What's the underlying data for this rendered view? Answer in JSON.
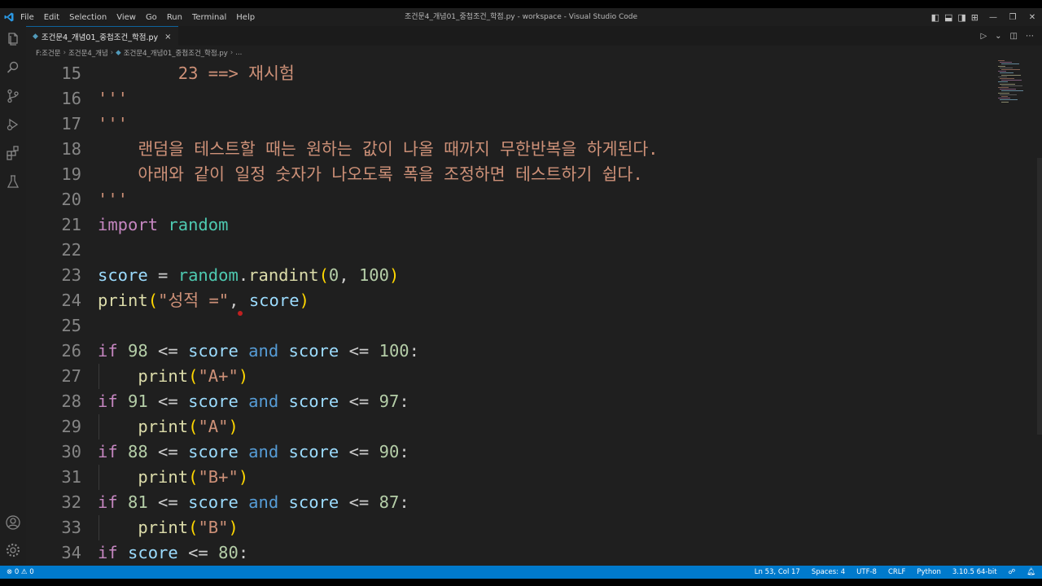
{
  "titlebar": {
    "menu": [
      "File",
      "Edit",
      "Selection",
      "View",
      "Go",
      "Run",
      "Terminal",
      "Help"
    ],
    "title": "조건문4_개념01_중첩조건_학점.py - workspace - Visual Studio Code"
  },
  "tabs": [
    {
      "label": "조건문4_개념01_중첩조건_학점.py",
      "close": "×"
    }
  ],
  "breadcrumb": {
    "items": [
      "F:조건문",
      "조건문4_개념",
      "조건문4_개념01_중첩조건_학점.py",
      "..."
    ]
  },
  "editor": {
    "lines": [
      {
        "n": "15",
        "tokens": [
          {
            "t": "        ",
            "c": ""
          },
          {
            "t": "23 ==> 재시험",
            "c": "str"
          }
        ]
      },
      {
        "n": "16",
        "tokens": [
          {
            "t": "'''",
            "c": "str"
          }
        ]
      },
      {
        "n": "17",
        "tokens": [
          {
            "t": "'''",
            "c": "str"
          }
        ]
      },
      {
        "n": "18",
        "tokens": [
          {
            "t": "    랜덤을 테스트할 때는 원하는 값이 나올 때까지 무한반복을 하게된다.",
            "c": "str"
          }
        ]
      },
      {
        "n": "19",
        "tokens": [
          {
            "t": "    아래와 같이 일정 숫자가 나오도록 폭을 조정하면 테스트하기 쉽다.",
            "c": "str"
          }
        ]
      },
      {
        "n": "20",
        "tokens": [
          {
            "t": "'''",
            "c": "str"
          }
        ]
      },
      {
        "n": "21",
        "tokens": [
          {
            "t": "import",
            "c": "kw"
          },
          {
            "t": " ",
            "c": ""
          },
          {
            "t": "random",
            "c": "mod"
          }
        ]
      },
      {
        "n": "22",
        "tokens": []
      },
      {
        "n": "23",
        "tokens": [
          {
            "t": "score",
            "c": "var"
          },
          {
            "t": " = ",
            "c": "pun"
          },
          {
            "t": "random",
            "c": "mod"
          },
          {
            "t": ".",
            "c": "pun"
          },
          {
            "t": "randint",
            "c": "fn"
          },
          {
            "t": "(",
            "c": "par"
          },
          {
            "t": "0",
            "c": "num"
          },
          {
            "t": ", ",
            "c": "pun"
          },
          {
            "t": "100",
            "c": "num"
          },
          {
            "t": ")",
            "c": "par"
          }
        ]
      },
      {
        "n": "24",
        "tokens": [
          {
            "t": "print",
            "c": "fn"
          },
          {
            "t": "(",
            "c": "par"
          },
          {
            "t": "\"성적 =\"",
            "c": "str"
          },
          {
            "t": ", ",
            "c": "pun"
          },
          {
            "t": "score",
            "c": "var"
          },
          {
            "t": ")",
            "c": "par"
          }
        ]
      },
      {
        "n": "25",
        "tokens": []
      },
      {
        "n": "26",
        "tokens": [
          {
            "t": "if",
            "c": "kw"
          },
          {
            "t": " ",
            "c": ""
          },
          {
            "t": "98",
            "c": "num"
          },
          {
            "t": " <= ",
            "c": "pun"
          },
          {
            "t": "score",
            "c": "var"
          },
          {
            "t": " ",
            "c": ""
          },
          {
            "t": "and",
            "c": "blue"
          },
          {
            "t": " ",
            "c": ""
          },
          {
            "t": "score",
            "c": "var"
          },
          {
            "t": " <= ",
            "c": "pun"
          },
          {
            "t": "100",
            "c": "num"
          },
          {
            "t": ":",
            "c": "pun"
          }
        ]
      },
      {
        "n": "27",
        "tokens": [
          {
            "t": "    ",
            "c": ""
          },
          {
            "t": "print",
            "c": "fn"
          },
          {
            "t": "(",
            "c": "par"
          },
          {
            "t": "\"A+\"",
            "c": "str"
          },
          {
            "t": ")",
            "c": "par"
          }
        ]
      },
      {
        "n": "28",
        "tokens": [
          {
            "t": "if",
            "c": "kw"
          },
          {
            "t": " ",
            "c": ""
          },
          {
            "t": "91",
            "c": "num"
          },
          {
            "t": " <= ",
            "c": "pun"
          },
          {
            "t": "score",
            "c": "var"
          },
          {
            "t": " ",
            "c": ""
          },
          {
            "t": "and",
            "c": "blue"
          },
          {
            "t": " ",
            "c": ""
          },
          {
            "t": "score",
            "c": "var"
          },
          {
            "t": " <= ",
            "c": "pun"
          },
          {
            "t": "97",
            "c": "num"
          },
          {
            "t": ":",
            "c": "pun"
          }
        ]
      },
      {
        "n": "29",
        "tokens": [
          {
            "t": "    ",
            "c": ""
          },
          {
            "t": "print",
            "c": "fn"
          },
          {
            "t": "(",
            "c": "par"
          },
          {
            "t": "\"A\"",
            "c": "str"
          },
          {
            "t": ")",
            "c": "par"
          }
        ]
      },
      {
        "n": "30",
        "tokens": [
          {
            "t": "if",
            "c": "kw"
          },
          {
            "t": " ",
            "c": ""
          },
          {
            "t": "88",
            "c": "num"
          },
          {
            "t": " <= ",
            "c": "pun"
          },
          {
            "t": "score",
            "c": "var"
          },
          {
            "t": " ",
            "c": ""
          },
          {
            "t": "and",
            "c": "blue"
          },
          {
            "t": " ",
            "c": ""
          },
          {
            "t": "score",
            "c": "var"
          },
          {
            "t": " <= ",
            "c": "pun"
          },
          {
            "t": "90",
            "c": "num"
          },
          {
            "t": ":",
            "c": "pun"
          }
        ]
      },
      {
        "n": "31",
        "tokens": [
          {
            "t": "    ",
            "c": ""
          },
          {
            "t": "print",
            "c": "fn"
          },
          {
            "t": "(",
            "c": "par"
          },
          {
            "t": "\"B+\"",
            "c": "str"
          },
          {
            "t": ")",
            "c": "par"
          }
        ]
      },
      {
        "n": "32",
        "tokens": [
          {
            "t": "if",
            "c": "kw"
          },
          {
            "t": " ",
            "c": ""
          },
          {
            "t": "81",
            "c": "num"
          },
          {
            "t": " <= ",
            "c": "pun"
          },
          {
            "t": "score",
            "c": "var"
          },
          {
            "t": " ",
            "c": ""
          },
          {
            "t": "and",
            "c": "blue"
          },
          {
            "t": " ",
            "c": ""
          },
          {
            "t": "score",
            "c": "var"
          },
          {
            "t": " <= ",
            "c": "pun"
          },
          {
            "t": "87",
            "c": "num"
          },
          {
            "t": ":",
            "c": "pun"
          }
        ]
      },
      {
        "n": "33",
        "tokens": [
          {
            "t": "    ",
            "c": ""
          },
          {
            "t": "print",
            "c": "fn"
          },
          {
            "t": "(",
            "c": "par"
          },
          {
            "t": "\"B\"",
            "c": "str"
          },
          {
            "t": ")",
            "c": "par"
          }
        ]
      },
      {
        "n": "34",
        "tokens": [
          {
            "t": "if",
            "c": "kw"
          },
          {
            "t": " ",
            "c": ""
          },
          {
            "t": "score",
            "c": "var"
          },
          {
            "t": " <= ",
            "c": "pun"
          },
          {
            "t": "80",
            "c": "num"
          },
          {
            "t": ":",
            "c": "pun"
          }
        ]
      }
    ]
  },
  "status": {
    "problems": "⊗ 0 ⚠ 0",
    "position": "Ln 53, Col 17",
    "spaces": "Spaces: 4",
    "encoding": "UTF-8",
    "eol": "CRLF",
    "language": "Python",
    "interpreter": "3.10.5 64-bit"
  },
  "colors": {
    "status_bar": "#007acc",
    "editor_bg": "#1f1f1f",
    "keyword": "#c586c0",
    "string": "#ce9178",
    "number": "#b5cea8",
    "function": "#dcdcaa",
    "variable": "#9cdcfe",
    "module": "#4ec9b0"
  },
  "icons": [
    "vscode-logo-icon",
    "explorer-icon",
    "search-icon",
    "source-control-icon",
    "run-debug-icon",
    "extensions-icon",
    "testing-icon",
    "account-icon",
    "settings-gear-icon",
    "run-file-icon",
    "split-editor-icon",
    "more-actions-icon"
  ]
}
